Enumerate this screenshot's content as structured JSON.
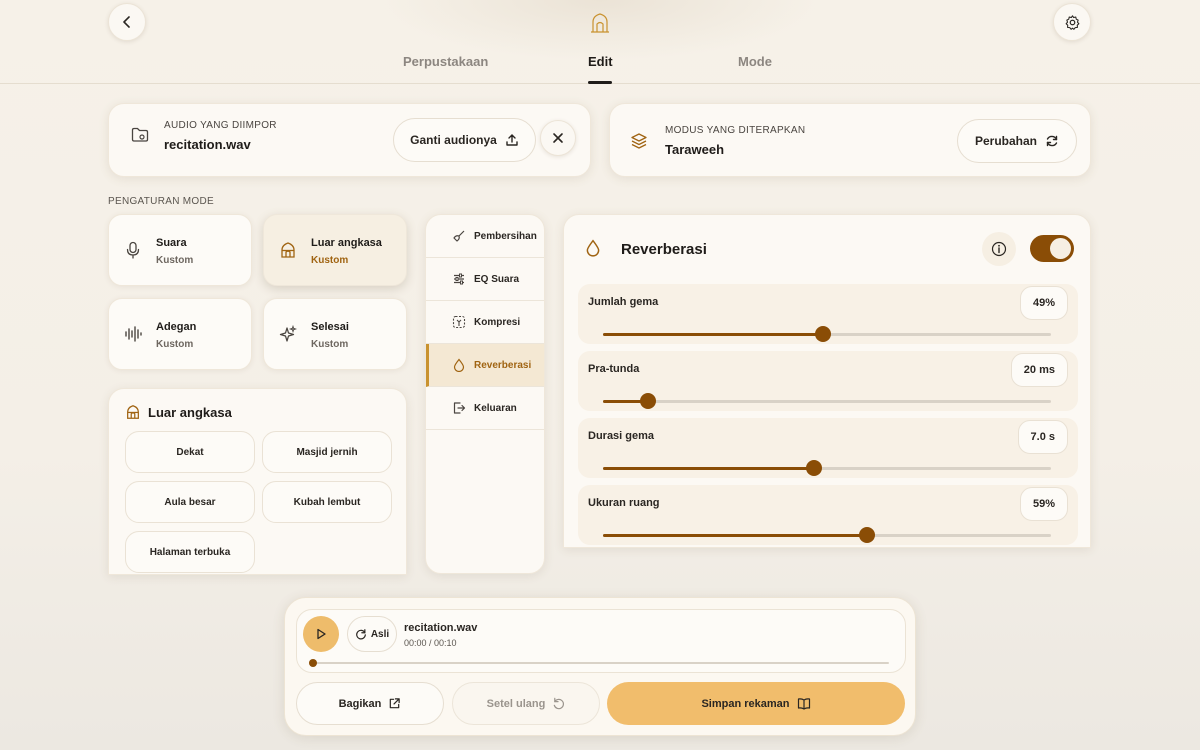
{
  "tabs": [
    {
      "label": "Perpustakaan",
      "active": false
    },
    {
      "label": "Edit",
      "active": true
    },
    {
      "label": "Mode",
      "active": false
    }
  ],
  "audio_card": {
    "caption": "AUDIO YANG DIIMPOR",
    "file_name": "recitation.wav",
    "change_label": "Ganti audionya"
  },
  "mode_card": {
    "caption": "MODUS YANG DITERAPKAN",
    "mode_name": "Taraweeh",
    "change_label": "Perubahan"
  },
  "mode_settings_label": "PENGATURAN MODE",
  "mode_tiles": [
    {
      "title": "Suara",
      "sub": "Kustom",
      "icon": "microphone-icon",
      "active": false
    },
    {
      "title": "Luar angkasa",
      "sub": "Kustom",
      "icon": "mosque-icon",
      "active": true
    },
    {
      "title": "Adegan",
      "sub": "Kustom",
      "icon": "waveform-icon",
      "active": false
    },
    {
      "title": "Selesai",
      "sub": "Kustom",
      "icon": "sparkle-icon",
      "active": false
    }
  ],
  "presets": {
    "title": "Luar angkasa",
    "items": [
      "Dekat",
      "Masjid jernih",
      "Aula besar",
      "Kubah lembut",
      "Halaman terbuka"
    ]
  },
  "effects": [
    {
      "label": "Pembersihan",
      "icon": "broom-icon",
      "active": false
    },
    {
      "label": "EQ Suara",
      "icon": "sliders-icon",
      "active": false
    },
    {
      "label": "Kompresi",
      "icon": "compress-icon",
      "active": false
    },
    {
      "label": "Reverberasi",
      "icon": "droplet-icon",
      "active": true
    },
    {
      "label": "Keluaran",
      "icon": "output-icon",
      "active": false
    }
  ],
  "reverb": {
    "title": "Reverberasi",
    "enabled": true,
    "params": [
      {
        "label": "Jumlah gema",
        "value_text": "49%",
        "fraction": 0.49
      },
      {
        "label": "Pra-tunda",
        "value_text": "20 ms",
        "fraction": 0.1
      },
      {
        "label": "Durasi gema",
        "value_text": "7.0 s",
        "fraction": 0.47
      },
      {
        "label": "Ukuran ruang",
        "value_text": "59%",
        "fraction": 0.59
      }
    ]
  },
  "player": {
    "original_label": "Asli",
    "file_name": "recitation.wav",
    "time": "00:00 / 00:10",
    "progress": 0.0,
    "share_label": "Bagikan",
    "reset_label": "Setel ulang",
    "save_label": "Simpan rekaman"
  },
  "colors": {
    "accent": "#8a4d06",
    "accent_light": "#eebc6b",
    "active_text": "#a06412"
  }
}
